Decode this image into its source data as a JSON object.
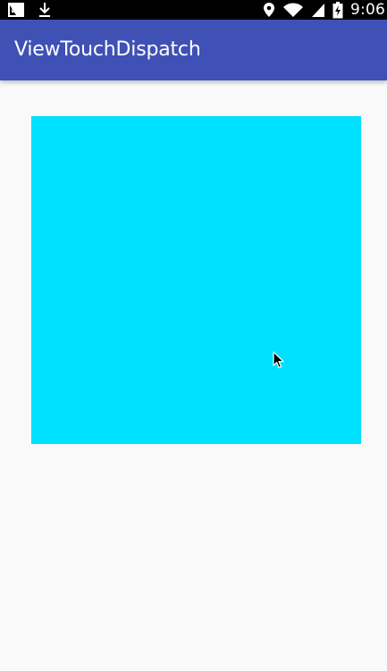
{
  "status_bar": {
    "time": "9:06",
    "left_icons": [
      "screenshot-icon",
      "download-icon"
    ],
    "right_icons": [
      "location-icon",
      "wifi-icon",
      "signal-icon",
      "battery-charging-icon"
    ]
  },
  "app_bar": {
    "title": "ViewTouchDispatch",
    "color": "#3f51b5"
  },
  "content": {
    "background": "#f9f9f9",
    "custom_view": {
      "color": "#00e0ff"
    },
    "cursor_icon": "mouse-pointer-icon"
  }
}
